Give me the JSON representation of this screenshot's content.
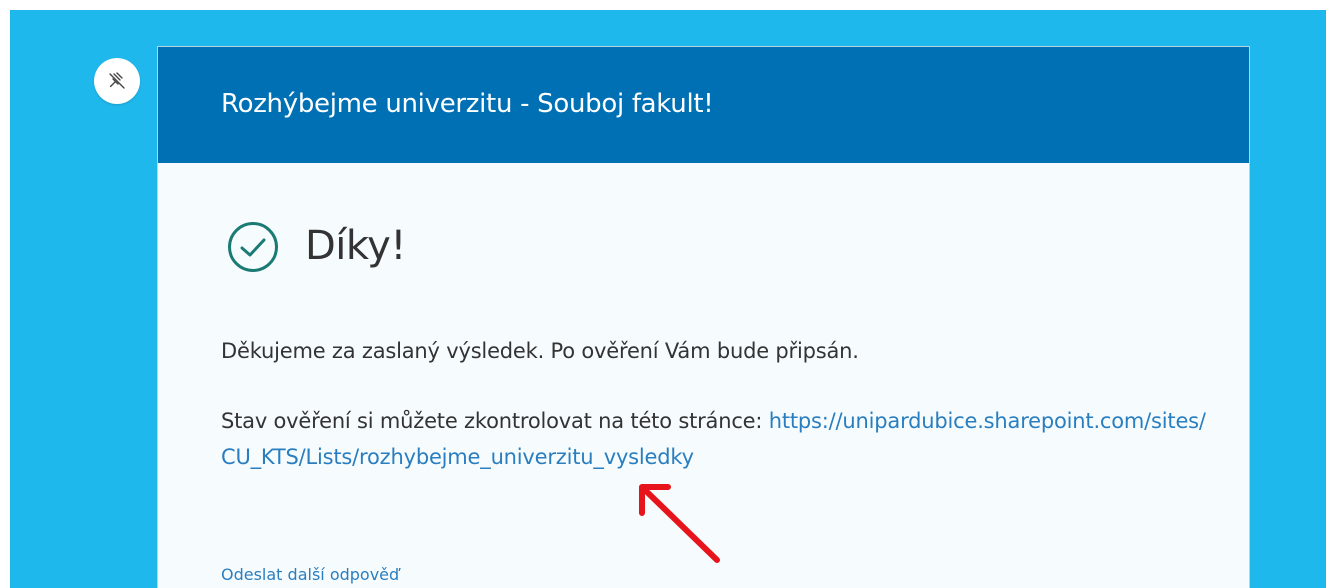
{
  "form": {
    "title": "Rozhýbejme univerzitu - Souboj fakult!"
  },
  "confirmation": {
    "heading": "Díky!",
    "message": "Děkujeme za zaslaný výsledek. Po ověření Vám bude připsán.",
    "status_prefix": "Stav ověření si můžete zkontrolovat na této stránce: ",
    "status_link": "https://unipardubice.sharepoint.com/sites/CU_KTS/Lists/rozhybejme_univerzitu_vysledky",
    "submit_another": "Odeslat další odpověď"
  },
  "icons": {
    "pin": "unpin-icon",
    "success": "check-circle-icon",
    "annotation": "red-arrow-icon"
  },
  "colors": {
    "page_background": "#1fb8ec",
    "header": "#0070b5",
    "link": "#2a7ebf",
    "success_icon": "#1a7a74",
    "annotation": "#e8141c"
  }
}
